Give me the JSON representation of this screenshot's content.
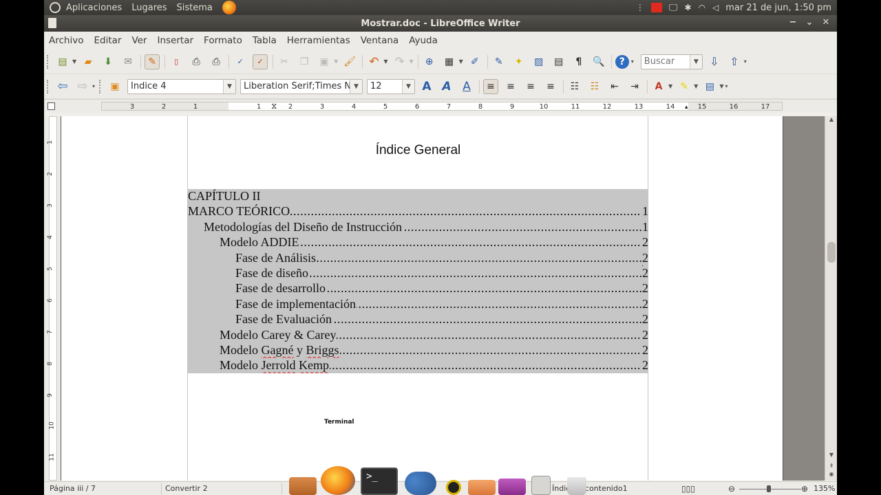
{
  "top_panel": {
    "apps_menu": "Aplicaciones",
    "places_menu": "Lugares",
    "system_menu": "Sistema",
    "clock": "mar 21 de jun,  1:50 pm"
  },
  "window": {
    "title": "Mostrar.doc - LibreOffice Writer",
    "buttons": [
      "−",
      "⌄",
      "✕"
    ]
  },
  "menubar": [
    "Archivo",
    "Editar",
    "Ver",
    "Insertar",
    "Formato",
    "Tabla",
    "Herramientas",
    "Ventana",
    "Ayuda"
  ],
  "toolbar": {
    "search_placeholder": "Buscar",
    "paragraph_style": "Índice 4",
    "font_name": "Liberation Serif;Times N",
    "font_size": "12"
  },
  "ruler": {
    "ticks": [
      "3",
      "2",
      "1",
      "1",
      "2",
      "3",
      "4",
      "5",
      "6",
      "7",
      "8",
      "9",
      "10",
      "11",
      "12",
      "13",
      "14",
      "15",
      "16",
      "17"
    ],
    "v_ticks": [
      "1",
      "2",
      "3",
      "4",
      "5",
      "6",
      "7",
      "8",
      "9",
      "10",
      "11"
    ]
  },
  "document": {
    "title": "Índice General",
    "toc": [
      {
        "text": "CAPÍTULO II",
        "page": "",
        "level": 0
      },
      {
        "text": "MARCO TEÓRICO",
        "page": "1",
        "level": 0
      },
      {
        "text": "Metodologías del Diseño de Instrucción",
        "page": "1",
        "level": 1
      },
      {
        "text": "Modelo ADDIE",
        "page": "2",
        "level": 2
      },
      {
        "text": "Fase de Análisis",
        "page": "2",
        "level": 3
      },
      {
        "text": "Fase de diseño",
        "page": "2",
        "level": 3
      },
      {
        "text": "Fase de desarrollo",
        "page": "2",
        "level": 3
      },
      {
        "text": "Fase de implementación",
        "page": "2",
        "level": 3
      },
      {
        "text": "Fase de Evaluación",
        "page": "2",
        "level": 3
      },
      {
        "text": "Modelo Carey & Carey",
        "page": "2",
        "level": 2
      },
      {
        "text": "Modelo Gagné y Briggs",
        "page": "2",
        "level": 2
      },
      {
        "text": "Modelo Jerrold Kemp",
        "page": "2",
        "level": 2
      }
    ],
    "tooltip": "Terminal"
  },
  "statusbar": {
    "page": "Página  iii / 7",
    "style": "Convertir 2",
    "index": "Índic",
    "section": "contenido1",
    "zoom": "135%"
  }
}
